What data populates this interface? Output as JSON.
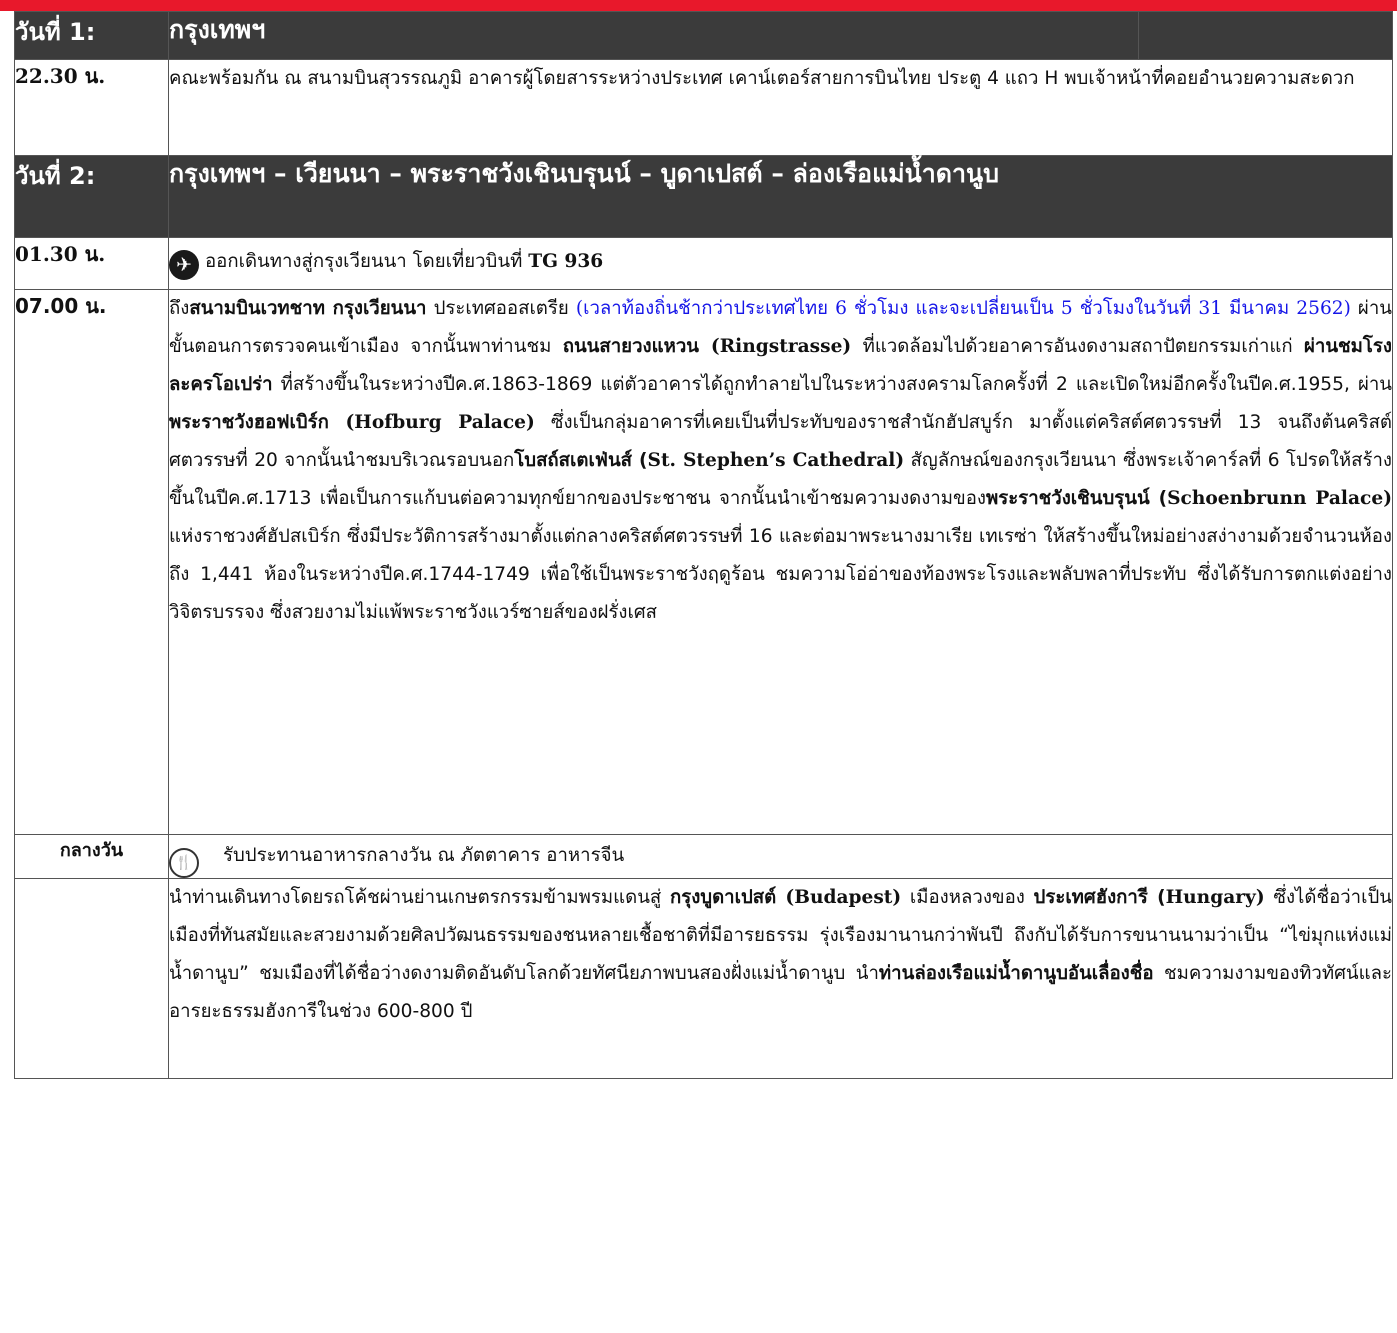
{
  "day1": {
    "label": "วันที่ 1:",
    "title": "กรุงเทพฯ",
    "rows": [
      {
        "time": "22.30 น.",
        "text": "คณะพร้อมกัน ณ สนามบินสุวรรณภูมิ อาคารผู้โดยสารระหว่างประเทศ เคาน์เตอร์สายการบินไทย ประตู 4 แถว H พบเจ้าหน้าที่คอยอำนวยความสะดวก"
      }
    ]
  },
  "day2": {
    "label": "วันที่ 2:",
    "title": "กรุงเทพฯ – เวียนนา – พระราชวังเชินบรุนน์ – บูดาเปสต์ – ล่องเรือแม่น้ำดานูบ",
    "flight": {
      "time": "01.30 น.",
      "icon": "airplane-icon",
      "text": "ออกเดินทางสู่กรุงเวียนนา โดยเที่ยวบินที่ ",
      "flight_no": "TG 936"
    },
    "arrival": {
      "time": "07.00 น.",
      "p1a": "ถึง",
      "p1b": "สนามบินเวทชาท กรุงเวียนนา",
      "p1c": " ประเทศออสเตรีย ",
      "p1d": "(เวลาท้องถิ่นช้ากว่าประเทศไทย 6 ชั่วโมง และจะเปลี่ยนเป็น 5 ชั่วโมงในวันที่ 31 มีนาคม 2562)",
      "p1e": " ผ่านขั้นตอนการตรวจคนเข้าเมือง จากนั้นพาท่านชม ",
      "p2a": "ถนนสายวงแหวน",
      "p2b": " (Ringstrasse)",
      "p2c": " ที่แวดล้อมไปด้วยอาคารอันงดงามสถาปัตยกรรมเก่าแก่ ",
      "p2d": "ผ่านชมโรงละครโอเปร่า",
      "p2e": " ที่สร้างขึ้นในระหว่างปีค.ศ.1863-1869 แต่ตัวอาคารได้ถูกทำลายไปในระหว่างสงครามโลกครั้งที่ 2 และเปิดใหม่อีกครั้งในปีค.ศ.1955, ผ่าน",
      "p3a": "พระราชวังฮอฟเบิร์ก",
      "p3b": " (Hofburg Palace)",
      "p3c": " ซึ่งเป็นกลุ่มอาคารที่เคยเป็นที่ประทับของราชสำนักฮัปสบูร์ก มาตั้งแต่คริสต์ศตวรรษที่ 13 จนถึงต้นคริสต์ศตวรรษที่ 20 จากนั้นนำชมบริเวณรอบนอก",
      "p4a": "โบสถ์สเตเฟ่นส์ (",
      "p4b": "St. Stephen’s Cathedral)",
      "p4c": " สัญลักษณ์ของกรุงเวียนนา ซึ่งพระเจ้าคาร์ลที่ 6 โปรดให้สร้างขึ้นในปีค.ศ.1713 เพื่อเป็นการแก้บนต่อความทุกข์ยากของประชาชน จากนั้นนำเข้าชมความงดงามของ",
      "p5a": "พระราชวังเชินบรุนน์ (",
      "p5b": "Schoenbrunn Palace)",
      "p5c": " แห่งราชวงศ์ฮัปสเบิร์ก ซึ่งมีประวัติการสร้างมาตั้งแต่กลางคริสต์ศตวรรษที่ 16 และต่อมาพระนางมาเรีย เทเรซ่า ให้สร้างขึ้นใหม่อย่างสง่างามด้วยจำนวนห้องถึง 1,441 ห้องในระหว่างปีค.ศ.1744-1749 เพื่อใช้เป็นพระราชวังฤดูร้อน ชมความโอ่อ่าของท้องพระโรงและพลับพลาที่ประทับ ซึ่งได้รับการตกแต่งอย่างวิจิตรบรรจง ซึ่งสวยงามไม่แพ้พระราชวังแวร์ซายส์ของฝรั่งเศส"
    },
    "lunch": {
      "time": "กลางวัน",
      "icon": "meal-icon",
      "text": "รับประทานอาหารกลางวัน ณ ภัตตาคาร อาหารจีน"
    },
    "afternoon": {
      "time": "",
      "q1": "นำท่านเดินทางโดยรถโค้ชผ่านย่านเกษตรกรรมข้ามพรมแดนสู่ ",
      "q2": "กรุงบูดาเปสต์",
      "q3": " (Budapest)",
      "q4": " เมืองหลวงของ ",
      "q5": "ประเทศฮังการี (",
      "q6": "Hungary)",
      "q7": " ซึ่งได้ชื่อว่าเป็นเมืองที่ทันสมัยและสวยงามด้วยศิลปวัฒนธรรมของชนหลายเชื้อชาติที่มีอารยธรรม รุ่งเรืองมานานกว่าพันปี ถึงกับได้รับการขนานนามว่าเป็น “ไข่มุกแห่งแม่น้ำดานูบ” ชมเมืองที่ได้ชื่อว่างดงามติดอันดับโลกด้วยทัศนียภาพบนสองฝั่งแม่น้ำดานูบ นำ",
      "q8": "ท่านล่องเรือแม่น้ำดานูบอันเลื่องชื่อ",
      "q9": " ชมความงามของทิวทัศน์และอารยะธรรมฮังการีในช่วง 600-800 ปี"
    }
  }
}
